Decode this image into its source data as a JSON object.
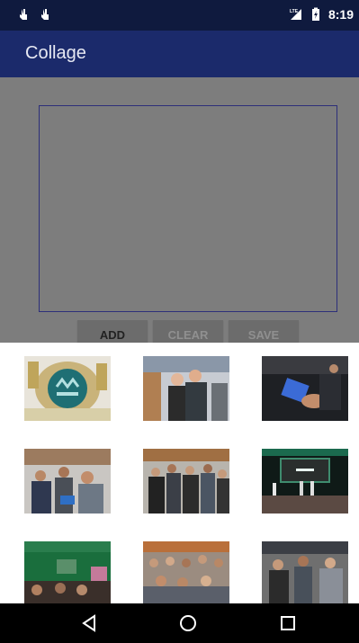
{
  "status_bar": {
    "time": "8:19",
    "network": "LTE",
    "icons": [
      "touch-icon",
      "touch-icon",
      "lte-signal-icon",
      "battery-icon"
    ]
  },
  "app_bar": {
    "title": "Collage"
  },
  "buttons": {
    "add": "ADD",
    "clear": "CLEAR",
    "save": "SAVE"
  },
  "picker": {
    "photos": [
      {
        "subject": "trophy-with-droidcon-logo"
      },
      {
        "subject": "two-people-posing-at-event"
      },
      {
        "subject": "hand-holding-tablet"
      },
      {
        "subject": "audience-seated-with-laptops"
      },
      {
        "subject": "crowded-conference-hall"
      },
      {
        "subject": "stage-presentation-green-screen"
      },
      {
        "subject": "speaker-at-podium"
      },
      {
        "subject": "audience-in-auditorium"
      },
      {
        "subject": "people-in-room"
      }
    ]
  },
  "nav_bar": {
    "icons": [
      "back-icon",
      "home-icon",
      "recents-icon"
    ]
  },
  "colors": {
    "status_bar": "#0f1a3e",
    "app_bar": "#1b2a6b",
    "scrim_content": "#7d7d7d",
    "canvas_border": "#2d2f7a"
  }
}
